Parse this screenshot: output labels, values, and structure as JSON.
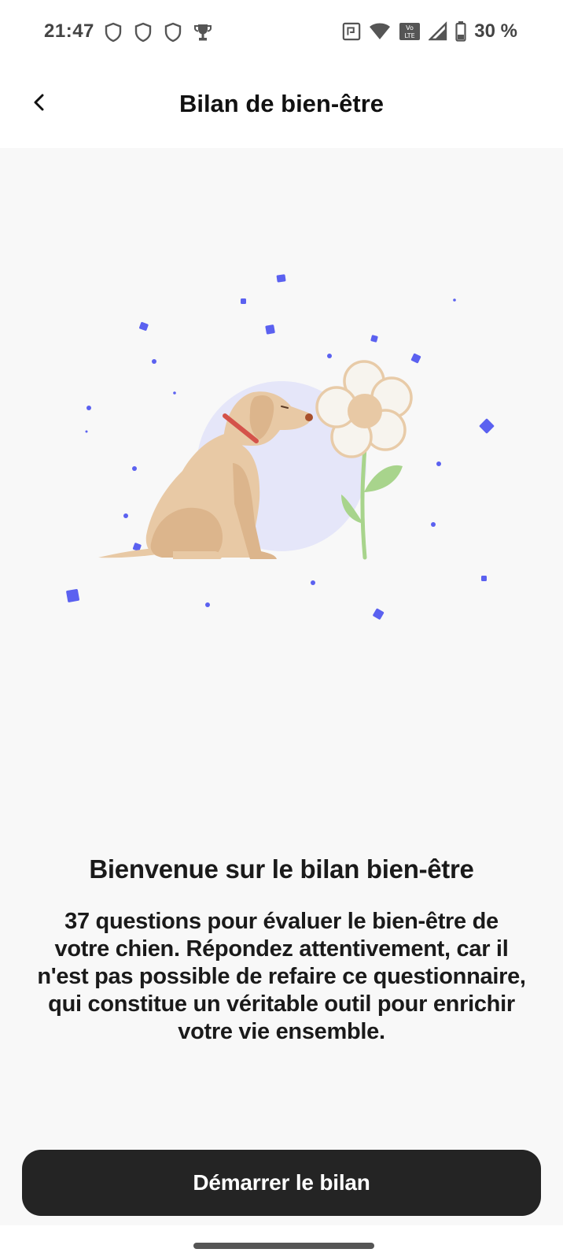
{
  "status_bar": {
    "time": "21:47",
    "left_icons": [
      "shield-icon",
      "shield-icon",
      "shield-icon",
      "trophy-icon"
    ],
    "right_icons": [
      "nfc-icon",
      "wifi-icon",
      "volte-icon",
      "signal-icon",
      "battery-icon"
    ],
    "battery_text": "30 %"
  },
  "header": {
    "title": "Bilan de bien-être",
    "back_icon": "chevron-left-icon"
  },
  "illustration": {
    "subject": "dog-sniffing-flower",
    "colors": {
      "circle": "#e5e6f9",
      "dog": "#e8c9a5",
      "dog_shade": "#dcb58c",
      "collar": "#d4524a",
      "petal": "#f7f4ee",
      "petal_border": "#e8cba8",
      "flower_center": "#e8c9a5",
      "stem": "#a8d48c",
      "confetti": "#5b61f0"
    }
  },
  "content": {
    "title": "Bienvenue sur le bilan bien-être",
    "description_lines": [
      "37 questions pour évaluer le bien-être de",
      "votre chien. Répondez attentivement, car il",
      "n'est pas possible de refaire ce questionnaire,",
      "qui constitue un véritable outil pour enrichir",
      "votre vie ensemble."
    ]
  },
  "cta": {
    "label": "Démarrer le bilan"
  },
  "theme": {
    "background": "#f8f8f8",
    "button_bg": "#242424",
    "button_text": "#ffffff"
  }
}
